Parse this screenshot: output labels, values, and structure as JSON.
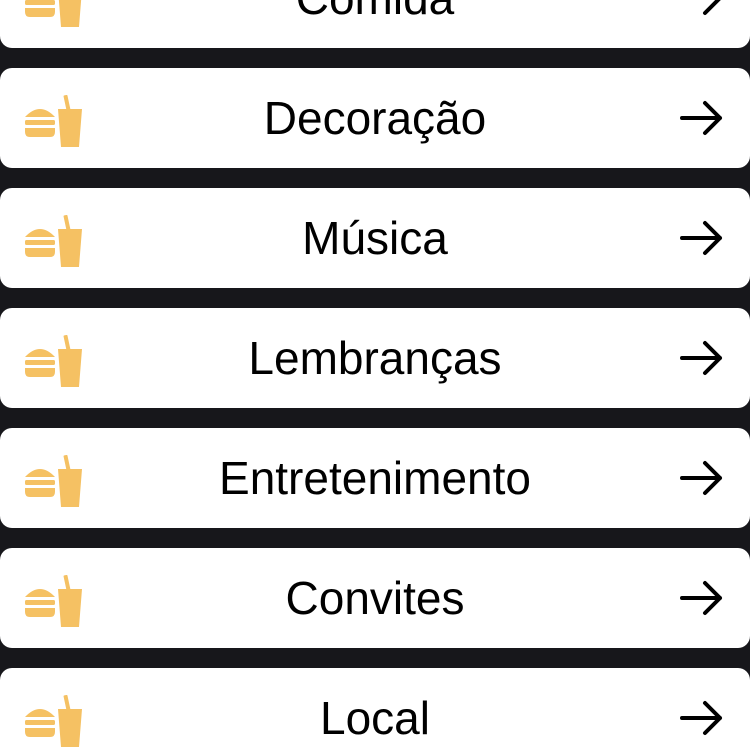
{
  "icon_color": "#f5c163",
  "background_color": "#17171b",
  "categories": [
    {
      "label": "Comida",
      "icon": "fast-food-icon"
    },
    {
      "label": "Decoração",
      "icon": "fast-food-icon"
    },
    {
      "label": "Música",
      "icon": "fast-food-icon"
    },
    {
      "label": "Lembranças",
      "icon": "fast-food-icon"
    },
    {
      "label": "Entretenimento",
      "icon": "fast-food-icon"
    },
    {
      "label": "Convites",
      "icon": "fast-food-icon"
    },
    {
      "label": "Local",
      "icon": "fast-food-icon"
    }
  ]
}
